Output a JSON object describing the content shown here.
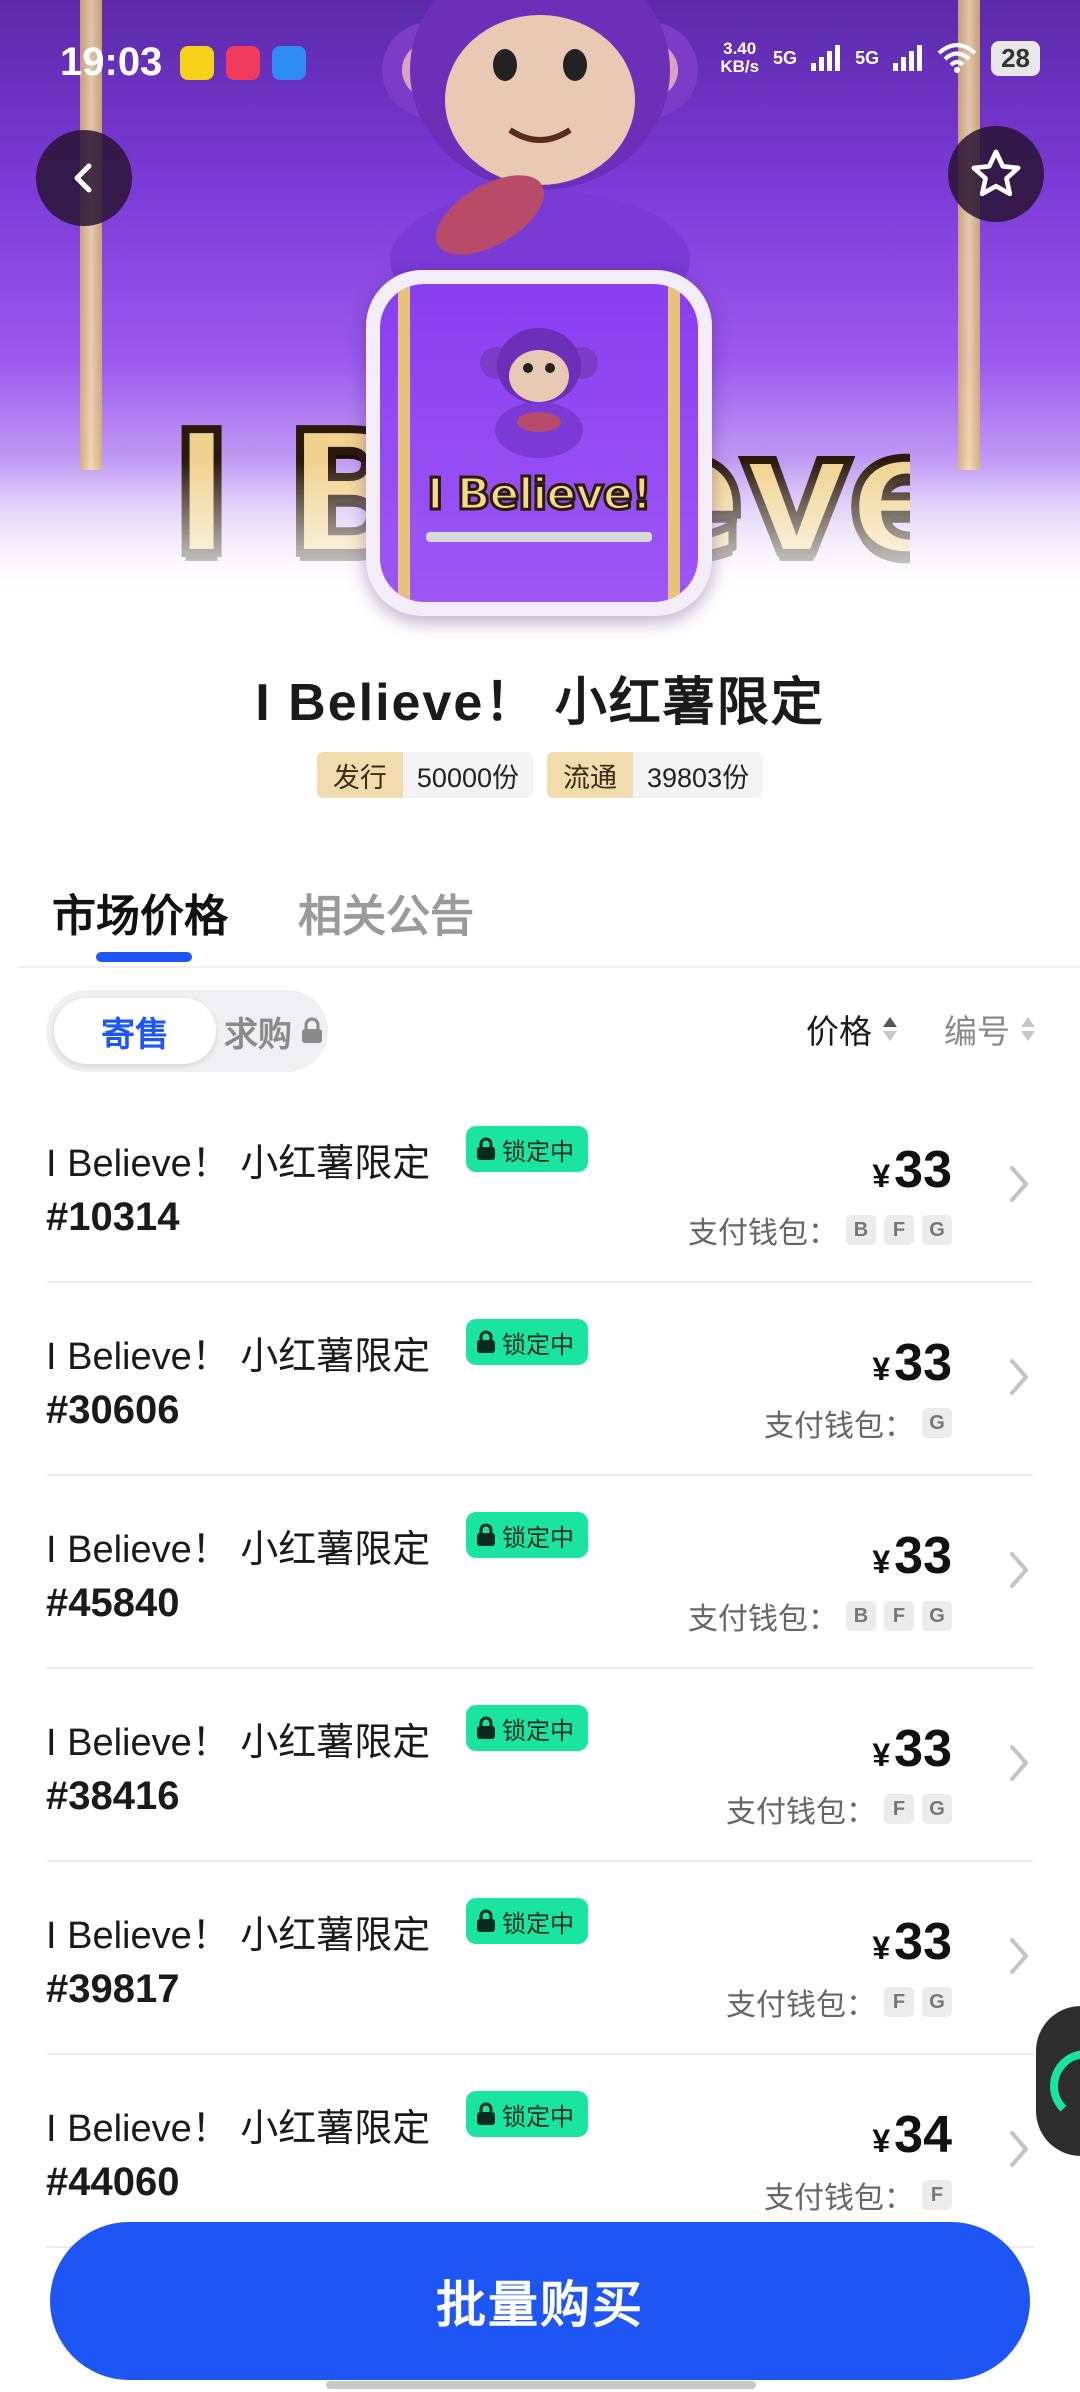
{
  "status_bar": {
    "time": "19:03",
    "net_speed_value": "3.40",
    "net_speed_unit": "KB/s",
    "signal_1": "5G",
    "signal_2": "5G",
    "battery": "28"
  },
  "hero": {
    "banner_text": "I Believe!",
    "card_text": "I Believe!",
    "colors": {
      "purple": "#7a3ad6",
      "gold": "#f0d28f"
    }
  },
  "product": {
    "title": "I Believe！ 小红薯限定",
    "stats": [
      {
        "label": "发行",
        "value": "50000份"
      },
      {
        "label": "流通",
        "value": "39803份"
      }
    ]
  },
  "tabs": [
    {
      "label": "市场价格",
      "active": true
    },
    {
      "label": "相关公告",
      "active": false
    }
  ],
  "filter": {
    "segment_on": "寄售",
    "segment_off": "求购",
    "sort_price": "价格",
    "sort_number": "编号"
  },
  "wallet_label": "支付钱包：",
  "listings": [
    {
      "name": "I Believe！ 小红薯限定",
      "badge": "锁定中",
      "serial": "#10314",
      "currency": "¥",
      "price": "33",
      "wallets": [
        "B",
        "F",
        "G"
      ]
    },
    {
      "name": "I Believe！ 小红薯限定",
      "badge": "锁定中",
      "serial": "#30606",
      "currency": "¥",
      "price": "33",
      "wallets": [
        "G"
      ]
    },
    {
      "name": "I Believe！ 小红薯限定",
      "badge": "锁定中",
      "serial": "#45840",
      "currency": "¥",
      "price": "33",
      "wallets": [
        "B",
        "F",
        "G"
      ]
    },
    {
      "name": "I Believe！ 小红薯限定",
      "badge": "锁定中",
      "serial": "#38416",
      "currency": "¥",
      "price": "33",
      "wallets": [
        "F",
        "G"
      ]
    },
    {
      "name": "I Believe！ 小红薯限定",
      "badge": "锁定中",
      "serial": "#39817",
      "currency": "¥",
      "price": "33",
      "wallets": [
        "F",
        "G"
      ]
    },
    {
      "name": "I Believe！ 小红薯限定",
      "badge": "锁定中",
      "serial": "#44060",
      "currency": "¥",
      "price": "34",
      "wallets": [
        "F"
      ]
    }
  ],
  "bulk_buy_label": "批量购买",
  "accent_color": "#1e55f5",
  "badge_color": "#19e5a0"
}
